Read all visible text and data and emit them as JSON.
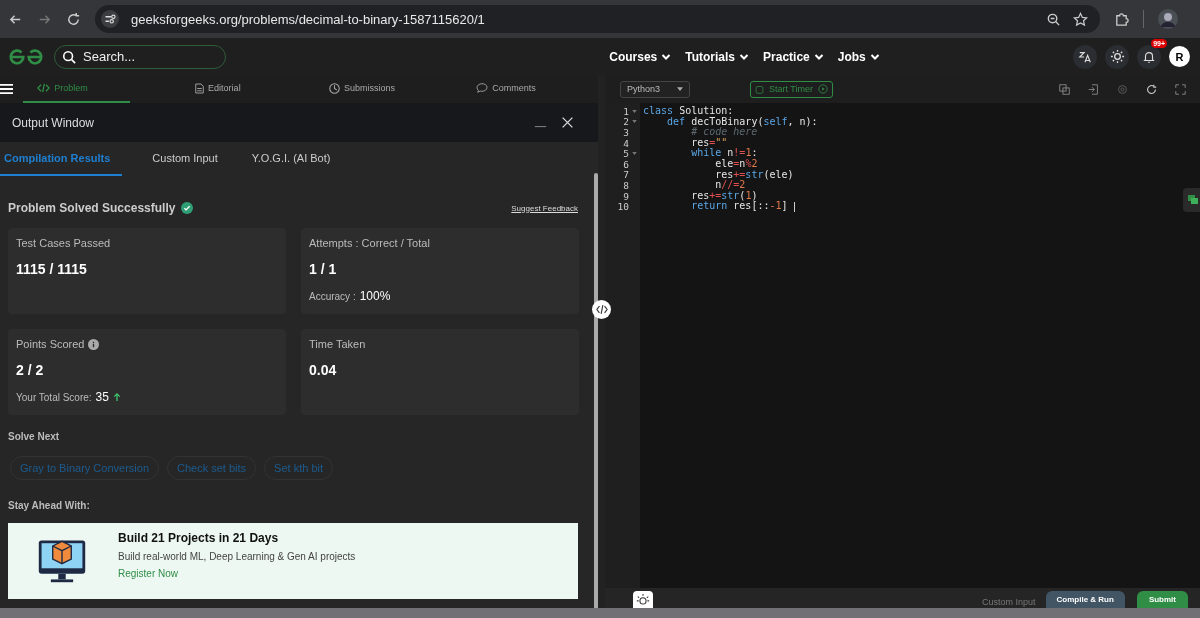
{
  "browser": {
    "url": "geeksforgeeks.org/problems/decimal-to-binary-1587115620/1"
  },
  "header": {
    "search": {
      "placeholder": "Search..."
    },
    "nav": [
      "Courses",
      "Tutorials",
      "Practice",
      "Jobs"
    ],
    "notifications": "99+",
    "avatar": "R"
  },
  "problem_tabs": [
    {
      "label": "Problem",
      "selected": true
    },
    {
      "label": "Editorial",
      "selected": false
    },
    {
      "label": "Submissions",
      "selected": false
    },
    {
      "label": "Comments",
      "selected": false
    }
  ],
  "output_window": {
    "title": "Output Window",
    "tabs": [
      {
        "label": "Compilation Results",
        "selected": true
      },
      {
        "label": "Custom Input",
        "selected": false
      },
      {
        "label": "Y.O.G.I. (AI Bot)",
        "selected": false
      }
    ],
    "status": "Problem Solved Successfully",
    "feedback_link": "Suggest Feedback",
    "cards": [
      {
        "label": "Test Cases Passed",
        "value": "1115 / 1115",
        "info": false
      },
      {
        "label": "Attempts : Correct / Total",
        "value": "1 / 1",
        "note_label": "Accuracy :",
        "note_value": "100%",
        "trend_up": false,
        "info": false
      },
      {
        "label": "Points Scored",
        "value": "2 / 2",
        "note_label": "Your Total Score:",
        "note_value": "35",
        "trend_up": true,
        "info": true
      },
      {
        "label": "Time Taken",
        "value": "0.04",
        "info": false
      }
    ],
    "solve_next_title": "Solve Next",
    "solve_next": [
      "Gray to Binary Conversion",
      "Check set bits",
      "Set kth bit"
    ],
    "stay_ahead_title": "Stay Ahead With:",
    "promo": {
      "title": "Build 21 Projects in 21 Days",
      "subtitle": "Build real-world ML, Deep Learning & Gen AI projects",
      "link": "Register Now"
    }
  },
  "editor": {
    "language": "Python3",
    "timer_button": "Start Timer",
    "lines": [
      {
        "number": "1",
        "fold": true,
        "tokens": [
          {
            "text": "class",
            "kind": "kw"
          },
          {
            "text": " Solution:",
            "kind": "plain"
          }
        ]
      },
      {
        "number": "2",
        "fold": true,
        "tokens": [
          {
            "text": "    def",
            "kind": "kw"
          },
          {
            "text": " decToBinary(",
            "kind": "plain"
          },
          {
            "text": "self",
            "kind": "kw"
          },
          {
            "text": ", n):",
            "kind": "plain"
          }
        ]
      },
      {
        "number": "3",
        "fold": false,
        "tokens": [
          {
            "text": "        # code here",
            "kind": "comment"
          }
        ]
      },
      {
        "number": "4",
        "fold": false,
        "tokens": [
          {
            "text": "        res",
            "kind": "plain"
          },
          {
            "text": "=",
            "kind": "op"
          },
          {
            "text": "\"\"",
            "kind": "str"
          }
        ]
      },
      {
        "number": "5",
        "fold": true,
        "tokens": [
          {
            "text": "        while",
            "kind": "kw"
          },
          {
            "text": " n",
            "kind": "plain"
          },
          {
            "text": "!=",
            "kind": "op"
          },
          {
            "text": "1",
            "kind": "num"
          },
          {
            "text": ":",
            "kind": "plain"
          }
        ]
      },
      {
        "number": "6",
        "fold": false,
        "tokens": [
          {
            "text": "            ele",
            "kind": "plain"
          },
          {
            "text": "=",
            "kind": "op"
          },
          {
            "text": "n",
            "kind": "plain"
          },
          {
            "text": "%",
            "kind": "op"
          },
          {
            "text": "2",
            "kind": "num"
          }
        ]
      },
      {
        "number": "7",
        "fold": false,
        "tokens": [
          {
            "text": "            res",
            "kind": "plain"
          },
          {
            "text": "+=",
            "kind": "op"
          },
          {
            "text": "str",
            "kind": "kw"
          },
          {
            "text": "(ele)",
            "kind": "plain"
          }
        ]
      },
      {
        "number": "8",
        "fold": false,
        "tokens": [
          {
            "text": "            n",
            "kind": "plain"
          },
          {
            "text": "//=",
            "kind": "op"
          },
          {
            "text": "2",
            "kind": "num"
          }
        ]
      },
      {
        "number": "9",
        "fold": false,
        "tokens": [
          {
            "text": "        res",
            "kind": "plain"
          },
          {
            "text": "+=",
            "kind": "op"
          },
          {
            "text": "str",
            "kind": "kw"
          },
          {
            "text": "(",
            "kind": "plain"
          },
          {
            "text": "1",
            "kind": "num"
          },
          {
            "text": ")",
            "kind": "plain"
          }
        ]
      },
      {
        "number": "10",
        "fold": false,
        "tokens": [
          {
            "text": "        return",
            "kind": "kw"
          },
          {
            "text": " res[::",
            "kind": "plain"
          },
          {
            "text": "-1",
            "kind": "num"
          },
          {
            "text": "]",
            "kind": "plain"
          }
        ]
      }
    ],
    "custom_input": "Custom Input",
    "compile_button": "Compile & Run",
    "submit_button": "Submit"
  }
}
